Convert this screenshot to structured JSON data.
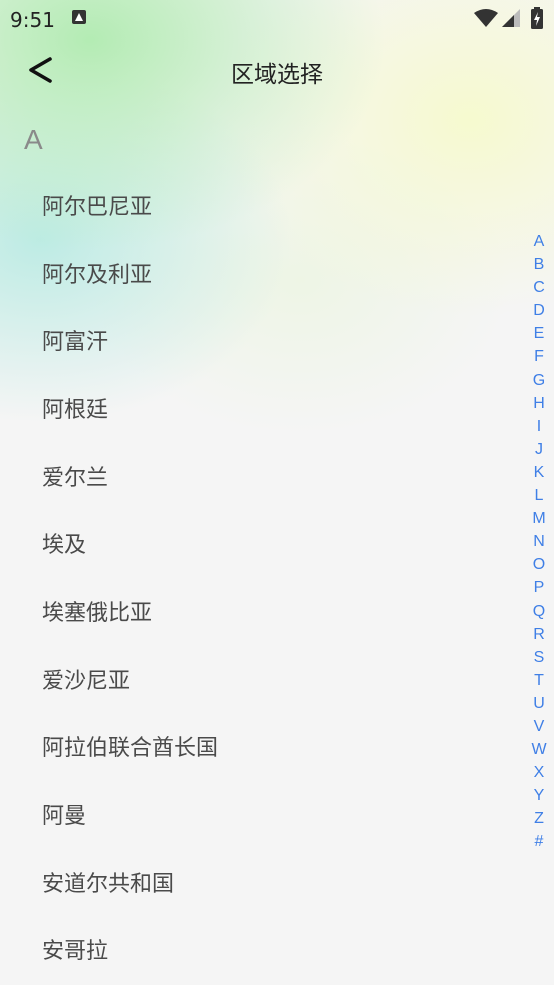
{
  "status_bar": {
    "time": "9:51"
  },
  "header": {
    "title": "区域选择"
  },
  "section": {
    "letter": "A"
  },
  "regions": [
    "阿尔巴尼亚",
    "阿尔及利亚",
    "阿富汗",
    "阿根廷",
    "爱尔兰",
    "埃及",
    "埃塞俄比亚",
    "爱沙尼亚",
    "阿拉伯联合酋长国",
    "阿曼",
    "安道尔共和国",
    "安哥拉"
  ],
  "index_letters": [
    "A",
    "B",
    "C",
    "D",
    "E",
    "F",
    "G",
    "H",
    "I",
    "J",
    "K",
    "L",
    "M",
    "N",
    "O",
    "P",
    "Q",
    "R",
    "S",
    "T",
    "U",
    "V",
    "W",
    "X",
    "Y",
    "Z",
    "#"
  ],
  "colors": {
    "index": "#3f7fe6",
    "list_text": "#4a4a4a",
    "section_letter": "#8a8a8a"
  }
}
